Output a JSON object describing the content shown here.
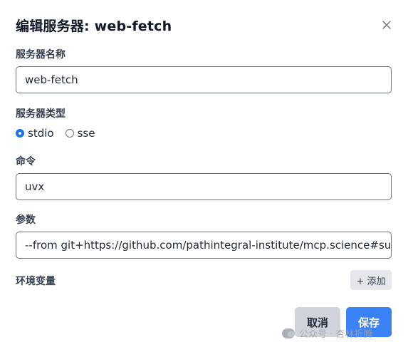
{
  "dialog": {
    "title": "编辑服务器: web-fetch"
  },
  "fields": {
    "name": {
      "label": "服务器名称",
      "value": "web-fetch"
    },
    "type": {
      "label": "服务器类型",
      "options": [
        {
          "label": "stdio",
          "checked": true
        },
        {
          "label": "sse",
          "checked": false
        }
      ]
    },
    "command": {
      "label": "命令",
      "value": "uvx"
    },
    "args": {
      "label": "参数",
      "value": "--from git+https://github.com/pathintegral-institute/mcp.science#subd"
    },
    "env": {
      "label": "环境变量",
      "add_label": "+ 添加"
    }
  },
  "footer": {
    "cancel_label": "取消",
    "save_label": "保存"
  },
  "watermark": {
    "text": "公众号 · 杏林折腾"
  },
  "colors": {
    "primary": "#3b82f6",
    "cancel": "#d1d5db"
  }
}
